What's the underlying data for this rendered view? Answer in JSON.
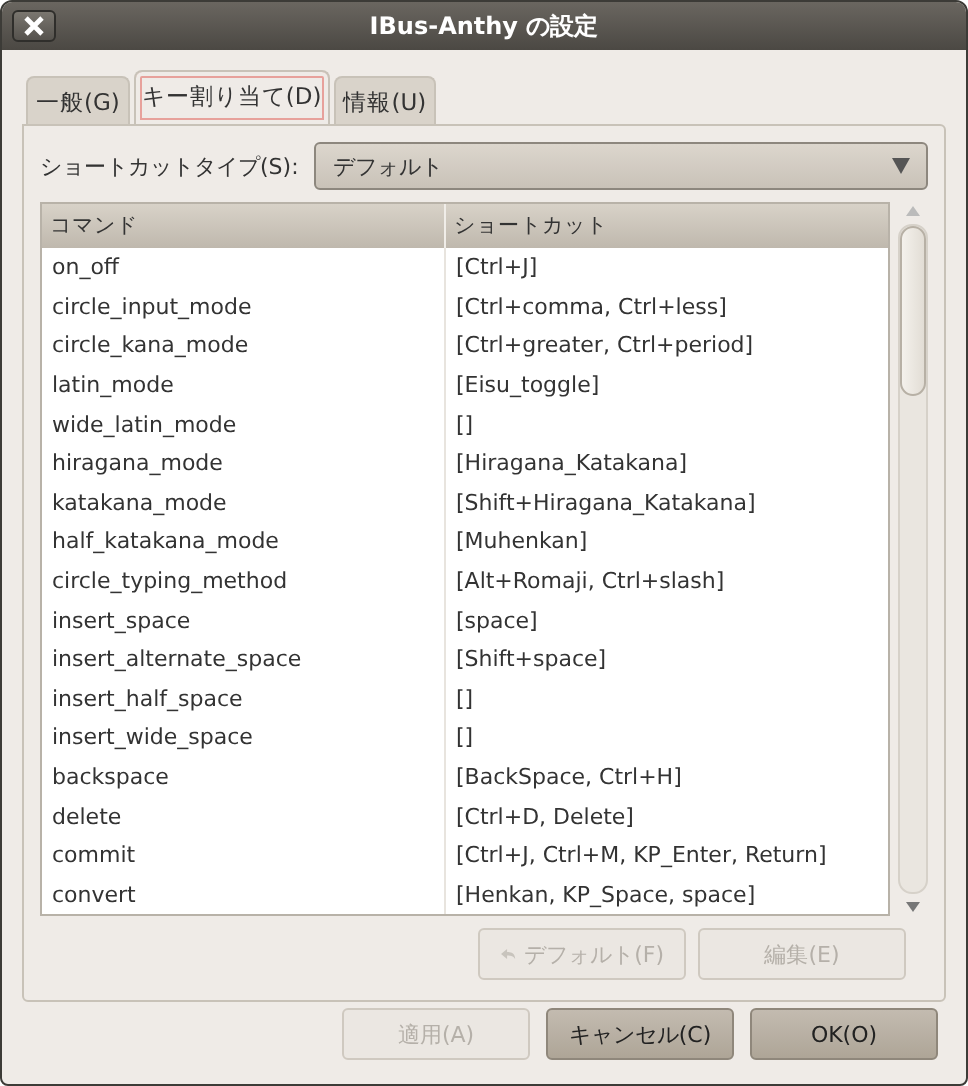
{
  "window": {
    "title": "IBus-Anthy の設定"
  },
  "tabs": [
    {
      "label": "一般(G)",
      "selected": false
    },
    {
      "label": "キー割り当て(D)",
      "selected": true
    },
    {
      "label": "情報(U)",
      "selected": false
    }
  ],
  "shortcut_type": {
    "label": "ショートカットタイプ(S):",
    "value": "デフォルト"
  },
  "table": {
    "columns": [
      "コマンド",
      "ショートカット"
    ],
    "rows": [
      [
        "on_off",
        "[Ctrl+J]"
      ],
      [
        "circle_input_mode",
        "[Ctrl+comma, Ctrl+less]"
      ],
      [
        "circle_kana_mode",
        "[Ctrl+greater, Ctrl+period]"
      ],
      [
        "latin_mode",
        "[Eisu_toggle]"
      ],
      [
        "wide_latin_mode",
        "[]"
      ],
      [
        "hiragana_mode",
        "[Hiragana_Katakana]"
      ],
      [
        "katakana_mode",
        "[Shift+Hiragana_Katakana]"
      ],
      [
        "half_katakana_mode",
        "[Muhenkan]"
      ],
      [
        "circle_typing_method",
        "[Alt+Romaji, Ctrl+slash]"
      ],
      [
        "insert_space",
        "[space]"
      ],
      [
        "insert_alternate_space",
        "[Shift+space]"
      ],
      [
        "insert_half_space",
        "[]"
      ],
      [
        "insert_wide_space",
        "[]"
      ],
      [
        "backspace",
        "[BackSpace, Ctrl+H]"
      ],
      [
        "delete",
        "[Ctrl+D, Delete]"
      ],
      [
        "commit",
        "[Ctrl+J, Ctrl+M, KP_Enter, Return]"
      ],
      [
        "convert",
        "[Henkan, KP_Space, space]"
      ]
    ]
  },
  "tab_buttons": [
    {
      "label": "デフォルト(F)",
      "disabled": true,
      "icon": true
    },
    {
      "label": "編集(E)",
      "disabled": true,
      "icon": false
    }
  ],
  "dialog_buttons": [
    {
      "label": "適用(A)",
      "disabled": true
    },
    {
      "label": "キャンセル(C)",
      "disabled": false
    },
    {
      "label": "OK(O)",
      "disabled": false
    }
  ]
}
